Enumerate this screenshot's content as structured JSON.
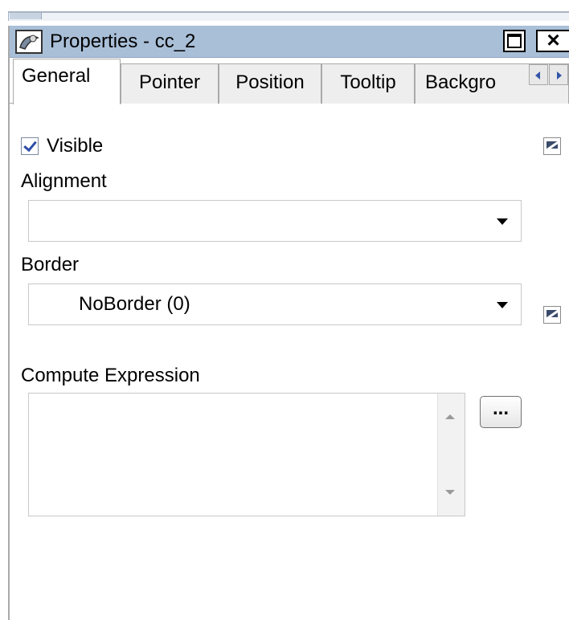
{
  "window": {
    "title": "Properties - cc_2"
  },
  "tabs": [
    {
      "label": "General",
      "active": true
    },
    {
      "label": "Pointer"
    },
    {
      "label": "Position"
    },
    {
      "label": "Tooltip"
    },
    {
      "label": "Backgro"
    }
  ],
  "general": {
    "visible": {
      "label": "Visible",
      "checked": true
    },
    "alignment": {
      "label": "Alignment",
      "value": ""
    },
    "border": {
      "label": "Border",
      "value": "NoBorder (0)"
    },
    "compute_expression": {
      "label": "Compute Expression",
      "value": "",
      "button_label": "..."
    }
  },
  "icons": {
    "window": "properties-window-icon",
    "maximize": "maximize-icon",
    "close": "close-icon",
    "scroll_left": "tab-scroll-left-icon",
    "scroll_right": "tab-scroll-right-icon",
    "edit": "edit-icon",
    "dropdown": "dropdown-arrow-icon"
  },
  "colors": {
    "titlebar": "#a9bfd8",
    "checkmark": "#2d4ea8"
  }
}
